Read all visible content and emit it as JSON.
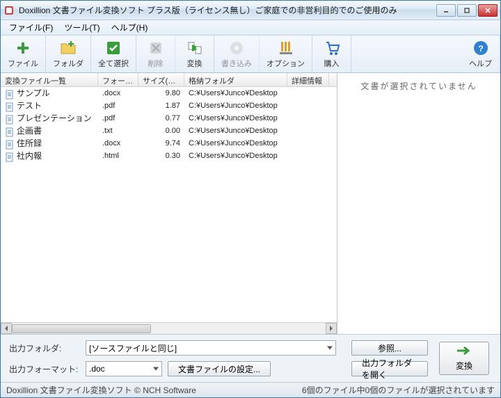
{
  "titlebar": {
    "text": "Doxillion 文書ファイル変換ソフト プラス版（ライセンス無し）ご家庭での非営利目的でのご使用のみ"
  },
  "menubar": {
    "file": "ファイル(F)",
    "tool": "ツール(T)",
    "help": "ヘルプ(H)"
  },
  "toolbar": {
    "file": "ファイル",
    "folder": "フォルダ",
    "select_all": "全て選択",
    "delete": "削除",
    "convert": "変換",
    "write": "書き込み",
    "options": "オプション",
    "buy": "購入",
    "help": "ヘルプ"
  },
  "columns": {
    "c0": "変換ファイル一覧",
    "c1": "フォーマ...",
    "c2": "サイズ(KB)",
    "c3": "格納フォルダ",
    "c4": "詳細情報"
  },
  "rows": [
    {
      "name": "サンプル",
      "fmt": ".docx",
      "size": "9.80",
      "folder": "C:¥Users¥Junco¥Desktop"
    },
    {
      "name": "テスト",
      "fmt": ".pdf",
      "size": "1.87",
      "folder": "C:¥Users¥Junco¥Desktop"
    },
    {
      "name": "プレゼンテーション",
      "fmt": ".pdf",
      "size": "0.77",
      "folder": "C:¥Users¥Junco¥Desktop"
    },
    {
      "name": "企画書",
      "fmt": ".txt",
      "size": "0.00",
      "folder": "C:¥Users¥Junco¥Desktop"
    },
    {
      "name": "住所録",
      "fmt": ".docx",
      "size": "9.74",
      "folder": "C:¥Users¥Junco¥Desktop"
    },
    {
      "name": "社内報",
      "fmt": ".html",
      "size": "0.30",
      "folder": "C:¥Users¥Junco¥Desktop"
    }
  ],
  "preview": {
    "empty_text": "文書が選択されていません"
  },
  "bottom": {
    "output_folder_label": "出力フォルダ:",
    "output_folder_value": "[ソースファイルと同じ]",
    "browse": "参照...",
    "output_format_label": "出力フォーマット:",
    "output_format_value": ".doc",
    "format_settings": "文書ファイルの設定...",
    "open_output": "出力フォルダを開く",
    "convert": "変換"
  },
  "statusbar": {
    "left": "Doxillion 文書ファイル変換ソフト © NCH Software",
    "right": "6個のファイル中0個のファイルが選択されています"
  }
}
